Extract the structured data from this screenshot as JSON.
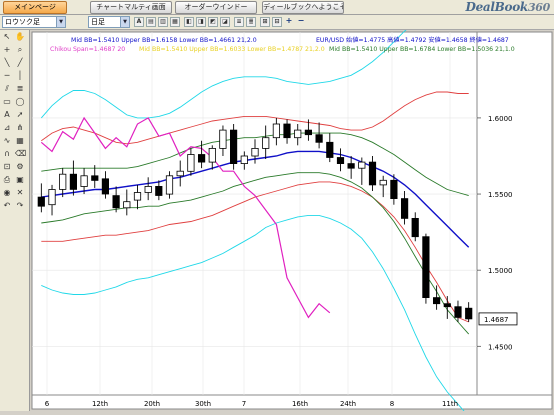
{
  "tabs": [
    {
      "label": "メインページ",
      "active": true
    },
    {
      "label": "チャートマルティ画面",
      "active": false
    },
    {
      "label": "オーダーウインドー",
      "active": false
    },
    {
      "label": "ディールブックへようこそ",
      "active": false
    }
  ],
  "logo": {
    "text": "DealBook",
    "suffix": "360"
  },
  "toolbar": {
    "chart_type": "ロウソク足",
    "period": "日足",
    "buttons": [
      "+",
      "−"
    ]
  },
  "legend": {
    "line1": {
      "left": "Mid BB=1.5410  Upper BB=1.6158  Lower BB=1.4661  21,2.0",
      "right": "EUR/USD 始値=1.4775  高値=1.4792  安値=1.4658  終値=1.4687"
    },
    "line2": [
      {
        "text": "Chikou Span=1.4687  20",
        "color": "#e040c8"
      },
      {
        "text": "Mid BB=1.5410  Upper BB=1.6033  Lower BB=1.4787  21,2.0",
        "color": "#e8d020"
      },
      {
        "text": "Mid BB=1.5410  Upper BB=1.6784  Lower BB=1.5036  21,1.0",
        "color": "#2a7a2a"
      }
    ]
  },
  "chart_data": {
    "type": "candlestick",
    "pair": "EUR/USD",
    "period": "daily",
    "ylim": [
      1.42,
      1.64
    ],
    "yticks": [
      {
        "label": "1.6000",
        "value": 1.6
      },
      {
        "label": "1.5500",
        "value": 1.55
      },
      {
        "label": "1.5000",
        "value": 1.5
      },
      {
        "label": "1.4500",
        "value": 1.45
      }
    ],
    "xticks": [
      "6",
      "12th",
      "20th",
      "30th",
      "7",
      "16th",
      "24th",
      "8",
      "11th"
    ],
    "last_price": "1.4687",
    "candles": [
      {
        "o": 1.548,
        "h": 1.557,
        "l": 1.538,
        "c": 1.542
      },
      {
        "o": 1.543,
        "h": 1.556,
        "l": 1.536,
        "c": 1.553
      },
      {
        "o": 1.553,
        "h": 1.567,
        "l": 1.548,
        "c": 1.563
      },
      {
        "o": 1.563,
        "h": 1.572,
        "l": 1.549,
        "c": 1.553
      },
      {
        "o": 1.555,
        "h": 1.567,
        "l": 1.55,
        "c": 1.562
      },
      {
        "o": 1.562,
        "h": 1.569,
        "l": 1.554,
        "c": 1.559
      },
      {
        "o": 1.56,
        "h": 1.565,
        "l": 1.547,
        "c": 1.55
      },
      {
        "o": 1.549,
        "h": 1.555,
        "l": 1.538,
        "c": 1.541
      },
      {
        "o": 1.541,
        "h": 1.553,
        "l": 1.536,
        "c": 1.545
      },
      {
        "o": 1.546,
        "h": 1.556,
        "l": 1.54,
        "c": 1.551
      },
      {
        "o": 1.551,
        "h": 1.561,
        "l": 1.546,
        "c": 1.555
      },
      {
        "o": 1.555,
        "h": 1.559,
        "l": 1.546,
        "c": 1.549
      },
      {
        "o": 1.55,
        "h": 1.565,
        "l": 1.547,
        "c": 1.562
      },
      {
        "o": 1.562,
        "h": 1.572,
        "l": 1.555,
        "c": 1.565
      },
      {
        "o": 1.565,
        "h": 1.58,
        "l": 1.562,
        "c": 1.576
      },
      {
        "o": 1.576,
        "h": 1.585,
        "l": 1.567,
        "c": 1.571
      },
      {
        "o": 1.571,
        "h": 1.582,
        "l": 1.566,
        "c": 1.58
      },
      {
        "o": 1.58,
        "h": 1.595,
        "l": 1.575,
        "c": 1.592
      },
      {
        "o": 1.592,
        "h": 1.596,
        "l": 1.566,
        "c": 1.57
      },
      {
        "o": 1.57,
        "h": 1.578,
        "l": 1.566,
        "c": 1.575
      },
      {
        "o": 1.575,
        "h": 1.586,
        "l": 1.57,
        "c": 1.58
      },
      {
        "o": 1.58,
        "h": 1.595,
        "l": 1.573,
        "c": 1.587
      },
      {
        "o": 1.587,
        "h": 1.6,
        "l": 1.582,
        "c": 1.596
      },
      {
        "o": 1.596,
        "h": 1.599,
        "l": 1.583,
        "c": 1.587
      },
      {
        "o": 1.587,
        "h": 1.596,
        "l": 1.582,
        "c": 1.592
      },
      {
        "o": 1.592,
        "h": 1.599,
        "l": 1.585,
        "c": 1.589
      },
      {
        "o": 1.589,
        "h": 1.597,
        "l": 1.58,
        "c": 1.584
      },
      {
        "o": 1.584,
        "h": 1.59,
        "l": 1.571,
        "c": 1.574
      },
      {
        "o": 1.574,
        "h": 1.58,
        "l": 1.565,
        "c": 1.57
      },
      {
        "o": 1.57,
        "h": 1.575,
        "l": 1.56,
        "c": 1.567
      },
      {
        "o": 1.567,
        "h": 1.574,
        "l": 1.556,
        "c": 1.571
      },
      {
        "o": 1.571,
        "h": 1.575,
        "l": 1.552,
        "c": 1.556
      },
      {
        "o": 1.556,
        "h": 1.562,
        "l": 1.548,
        "c": 1.559
      },
      {
        "o": 1.559,
        "h": 1.563,
        "l": 1.543,
        "c": 1.547
      },
      {
        "o": 1.547,
        "h": 1.552,
        "l": 1.53,
        "c": 1.534
      },
      {
        "o": 1.534,
        "h": 1.538,
        "l": 1.519,
        "c": 1.522
      },
      {
        "o": 1.522,
        "h": 1.524,
        "l": 1.478,
        "c": 1.482
      },
      {
        "o": 1.482,
        "h": 1.49,
        "l": 1.474,
        "c": 1.478
      },
      {
        "o": 1.478,
        "h": 1.483,
        "l": 1.468,
        "c": 1.476
      },
      {
        "o": 1.476,
        "h": 1.48,
        "l": 1.466,
        "c": 1.469
      },
      {
        "o": 1.475,
        "h": 1.479,
        "l": 1.466,
        "c": 1.468
      }
    ],
    "mid_bb": [
      1.548,
      1.549,
      1.55,
      1.551,
      1.552,
      1.553,
      1.553,
      1.554,
      1.555,
      1.556,
      1.557,
      1.558,
      1.56,
      1.561,
      1.563,
      1.565,
      1.567,
      1.569,
      1.571,
      1.572,
      1.573,
      1.574,
      1.575,
      1.577,
      1.578,
      1.578,
      1.578,
      1.577,
      1.576,
      1.574,
      1.571,
      1.568,
      1.565,
      1.561,
      1.556,
      1.55,
      1.543,
      1.536,
      1.529,
      1.522,
      1.515
    ],
    "upper_bb_2": [
      1.585,
      1.59,
      1.593,
      1.594,
      1.592,
      1.59,
      1.587,
      1.584,
      1.583,
      1.584,
      1.586,
      1.588,
      1.59,
      1.592,
      1.594,
      1.596,
      1.598,
      1.599,
      1.6,
      1.601,
      1.601,
      1.601,
      1.6,
      1.599,
      1.598,
      1.597,
      1.596,
      1.595,
      1.593,
      1.592,
      1.592,
      1.594,
      1.598,
      1.603,
      1.608,
      1.612,
      1.615,
      1.617,
      1.617,
      1.616,
      1.616
    ],
    "lower_bb_2": [
      1.519,
      1.519,
      1.519,
      1.52,
      1.521,
      1.522,
      1.523,
      1.523,
      1.524,
      1.525,
      1.526,
      1.528,
      1.53,
      1.531,
      1.532,
      1.534,
      1.536,
      1.539,
      1.542,
      1.545,
      1.548,
      1.55,
      1.552,
      1.554,
      1.556,
      1.557,
      1.558,
      1.558,
      1.557,
      1.555,
      1.552,
      1.548,
      1.542,
      1.535,
      1.526,
      1.515,
      1.503,
      1.492,
      1.48,
      1.469,
      1.466
    ],
    "upper_bb_1": [
      1.565,
      1.566,
      1.567,
      1.567,
      1.567,
      1.567,
      1.567,
      1.567,
      1.567,
      1.568,
      1.57,
      1.572,
      1.574,
      1.577,
      1.58,
      1.582,
      1.584,
      1.585,
      1.586,
      1.587,
      1.587,
      1.588,
      1.589,
      1.589,
      1.59,
      1.59,
      1.59,
      1.59,
      1.59,
      1.589,
      1.587,
      1.584,
      1.58,
      1.576,
      1.571,
      1.566,
      1.561,
      1.557,
      1.553,
      1.551,
      1.549
    ],
    "lower_bb_1": [
      1.531,
      1.532,
      1.533,
      1.535,
      1.537,
      1.538,
      1.539,
      1.54,
      1.541,
      1.541,
      1.542,
      1.542,
      1.544,
      1.545,
      1.546,
      1.548,
      1.55,
      1.552,
      1.555,
      1.557,
      1.559,
      1.561,
      1.562,
      1.563,
      1.564,
      1.564,
      1.564,
      1.563,
      1.561,
      1.558,
      1.554,
      1.548,
      1.541,
      1.532,
      1.521,
      1.509,
      1.497,
      1.486,
      1.474,
      1.466,
      1.458
    ],
    "upper_bb_3": [
      1.6,
      1.608,
      1.614,
      1.618,
      1.618,
      1.616,
      1.612,
      1.607,
      1.602,
      1.6,
      1.6,
      1.601,
      1.603,
      1.607,
      1.612,
      1.617,
      1.621,
      1.624,
      1.626,
      1.627,
      1.627,
      1.627,
      1.626,
      1.624,
      1.623,
      1.622,
      1.623,
      1.624,
      1.626,
      1.628,
      1.632,
      1.637,
      1.643,
      1.65,
      1.657,
      1.663,
      1.668,
      1.673,
      1.676,
      1.678,
      1.678
    ],
    "lower_bb_3": [
      1.49,
      1.487,
      1.485,
      1.484,
      1.484,
      1.485,
      1.487,
      1.489,
      1.492,
      1.494,
      1.495,
      1.497,
      1.499,
      1.501,
      1.503,
      1.505,
      1.508,
      1.511,
      1.515,
      1.519,
      1.523,
      1.528,
      1.531,
      1.533,
      1.535,
      1.536,
      1.536,
      1.534,
      1.531,
      1.527,
      1.521,
      1.512,
      1.501,
      1.488,
      1.474,
      1.458,
      1.443,
      1.43,
      1.42,
      1.412,
      1.404
    ],
    "chikou": [
      1.584,
      1.578,
      1.591,
      1.586,
      1.6,
      1.59,
      1.58,
      1.587,
      1.581,
      1.596,
      1.6,
      1.588,
      1.59,
      1.575,
      1.581,
      1.58,
      1.574,
      1.565,
      1.565,
      1.555,
      1.549,
      null,
      1.53,
      1.495,
      1.482,
      1.469,
      1.478,
      1.472,
      null,
      null,
      null,
      null,
      null,
      null,
      null,
      null,
      null,
      null,
      null,
      null,
      null
    ],
    "colors": {
      "candle_up": "#ffffff",
      "candle_down": "#000000",
      "mid_bb": "#1010c8",
      "upper_bb_2": "#e04040",
      "lower_bb_2": "#e04040",
      "band_1": "#2a7a2a",
      "band_3": "#20d8e8",
      "chikou": "#e020c0",
      "grid": "#e6e6e6",
      "background": "#ffffff"
    }
  }
}
